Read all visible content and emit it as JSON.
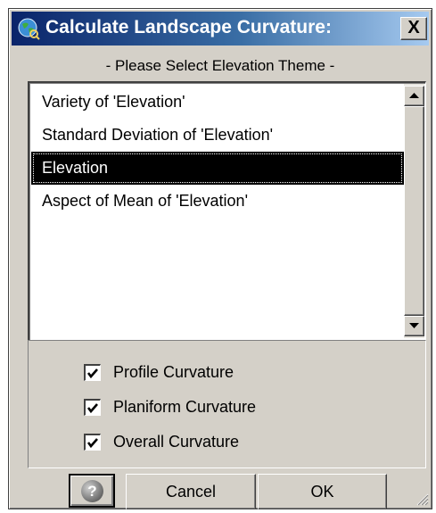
{
  "window": {
    "title": "Calculate Landscape Curvature:",
    "title_icon": "globe-icon",
    "close_label": "X"
  },
  "prompt": "- Please Select Elevation Theme -",
  "theme_list": {
    "items": [
      {
        "label": "Variety of 'Elevation'",
        "selected": false
      },
      {
        "label": "Standard Deviation of 'Elevation'",
        "selected": false
      },
      {
        "label": "Elevation",
        "selected": true
      },
      {
        "label": "Aspect of Mean of 'Elevation'",
        "selected": false
      }
    ]
  },
  "options": [
    {
      "label": "Profile Curvature",
      "checked": true
    },
    {
      "label": "Planiform Curvature",
      "checked": true
    },
    {
      "label": "Overall Curvature",
      "checked": true
    }
  ],
  "buttons": {
    "help_icon": "question-icon",
    "help_glyph": "?",
    "cancel": "Cancel",
    "ok": "OK"
  },
  "colors": {
    "titlebar_start": "#0a246a",
    "titlebar_end": "#a6caf0",
    "dialog_face": "#d4d0c8",
    "selection": "#000000"
  }
}
